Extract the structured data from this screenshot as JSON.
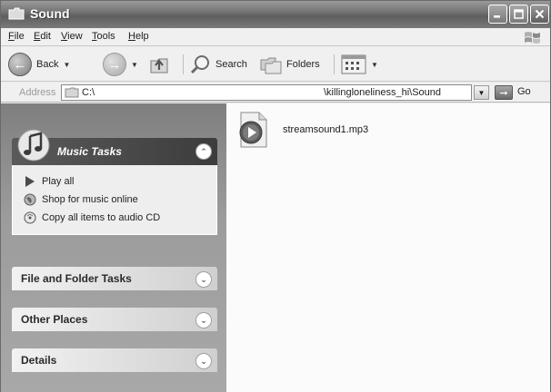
{
  "window": {
    "title": "Sound"
  },
  "menu": [
    {
      "label": "File",
      "key": "F",
      "rest": "ile"
    },
    {
      "label": "Edit",
      "key": "E",
      "rest": "dit"
    },
    {
      "label": "View",
      "key": "V",
      "rest": "iew"
    },
    {
      "label": "Tools",
      "key": "T",
      "rest": "ools"
    },
    {
      "label": "Help",
      "key": "H",
      "rest": "elp"
    }
  ],
  "toolbar": {
    "back_label": "Back",
    "search_label": "Search",
    "folders_label": "Folders"
  },
  "address": {
    "label": "Address",
    "drive": "C:\\",
    "path": "\\killingloneliness_hi\\Sound",
    "go_label": "Go"
  },
  "sidebar": {
    "music_tasks": {
      "title": "Music Tasks",
      "items": [
        {
          "label": "Play all",
          "icon": "play-icon"
        },
        {
          "label": "Shop for music online",
          "icon": "globe-icon"
        },
        {
          "label": "Copy all items to audio CD",
          "icon": "cd-copy-icon"
        }
      ]
    },
    "file_folder_tasks": {
      "title": "File and Folder Tasks"
    },
    "other_places": {
      "title": "Other Places"
    },
    "details": {
      "title": "Details"
    }
  },
  "files": [
    {
      "name": "streamsound1.mp3",
      "icon": "media-file-icon"
    }
  ],
  "colors": {
    "titlebar": "#6f6f6f",
    "panel_gradient_top": "#7f7f7f",
    "content_bg": "#fbfbfb"
  }
}
